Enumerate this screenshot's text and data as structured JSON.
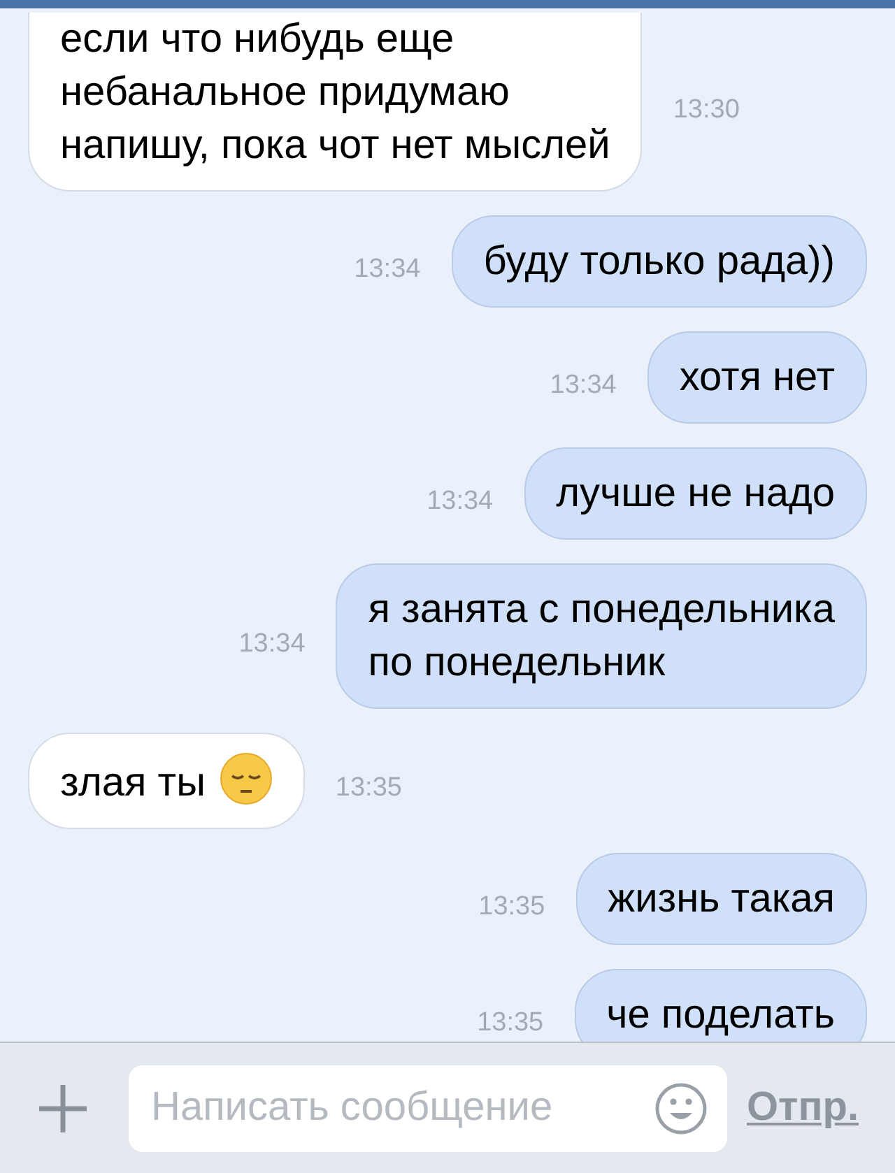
{
  "messages": [
    {
      "kind": "incoming",
      "lines": [
        "если что нибудь еще",
        "небанальное придумаю",
        "напишу, пока чот нет мыслей"
      ],
      "time": "13:30"
    },
    {
      "kind": "outgoing",
      "lines": [
        "буду только рада))"
      ],
      "time": "13:34"
    },
    {
      "kind": "outgoing",
      "lines": [
        "хотя нет"
      ],
      "time": "13:34"
    },
    {
      "kind": "outgoing",
      "lines": [
        "лучше не надо"
      ],
      "time": "13:34"
    },
    {
      "kind": "outgoing",
      "lines": [
        "я занята с понедельника",
        "по понедельник"
      ],
      "time": "13:34"
    },
    {
      "kind": "incoming",
      "lines": [
        "злая ты"
      ],
      "emoji": true,
      "time": "13:35"
    },
    {
      "kind": "outgoing",
      "lines": [
        "жизнь такая"
      ],
      "time": "13:35"
    },
    {
      "kind": "outgoing",
      "lines": [
        "че поделать"
      ],
      "time": "13:35"
    }
  ],
  "composer": {
    "placeholder": "Написать сообщение",
    "send": "Отпр."
  }
}
